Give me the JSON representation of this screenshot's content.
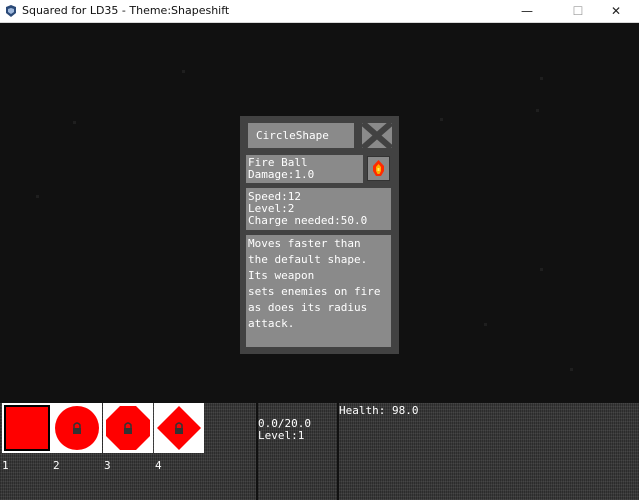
{
  "window": {
    "title": "Squared for LD35 - Theme:Shapeshift",
    "minimize": "—",
    "maximize": "☐",
    "close": "✕"
  },
  "colors": {
    "shape_red": "#ff0000",
    "panel_bg": "#424242",
    "box_bg": "#8a8a8a"
  },
  "popup": {
    "shape_name": "CircleShape",
    "weapon_name": "Fire Ball",
    "weapon_damage": "Damage:1.0",
    "weapon_icon": "fireball-icon",
    "stats": {
      "speed": "Speed:12",
      "level": "Level:2",
      "charge": "Charge needed:50.0"
    },
    "description_lines": [
      "Moves faster than",
      "the default shape.",
      "Its weapon",
      "sets enemies on fire",
      "as does its radius",
      "attack."
    ]
  },
  "hud": {
    "slots": [
      {
        "number": "1",
        "shape": "square",
        "locked": false
      },
      {
        "number": "2",
        "shape": "circle",
        "locked": true
      },
      {
        "number": "3",
        "shape": "octagon",
        "locked": true
      },
      {
        "number": "4",
        "shape": "diamond",
        "locked": true
      }
    ],
    "charge": "0.0/20.0",
    "level": "Level:1",
    "health": "Health: 98.0"
  }
}
